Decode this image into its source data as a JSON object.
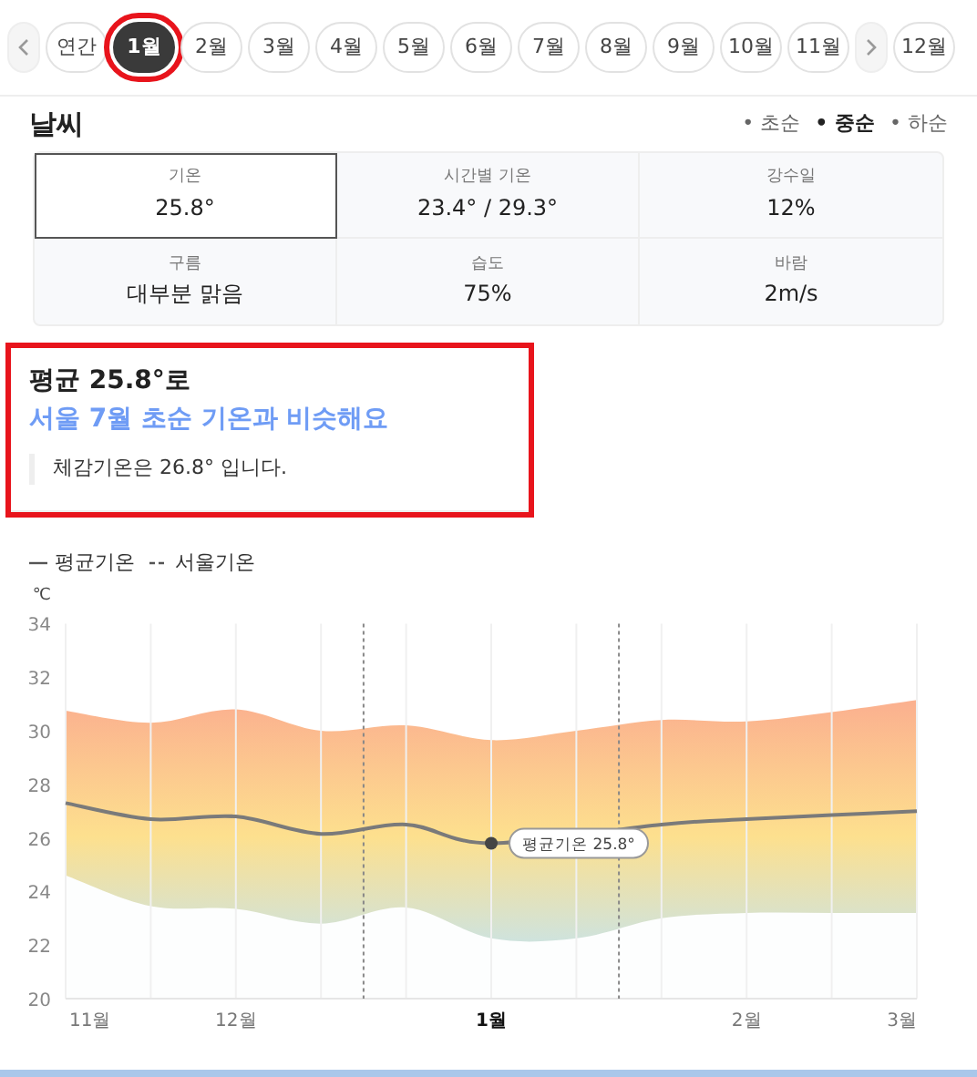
{
  "month_tabs": [
    {
      "label": "연간",
      "selected": false,
      "highlighted": false
    },
    {
      "label": "1월",
      "selected": true,
      "highlighted": true
    },
    {
      "label": "2월",
      "selected": false,
      "highlighted": false
    },
    {
      "label": "3월",
      "selected": false,
      "highlighted": false
    },
    {
      "label": "4월",
      "selected": false,
      "highlighted": false
    },
    {
      "label": "5월",
      "selected": false,
      "highlighted": false
    },
    {
      "label": "6월",
      "selected": false,
      "highlighted": false
    },
    {
      "label": "7월",
      "selected": false,
      "highlighted": false
    },
    {
      "label": "8월",
      "selected": false,
      "highlighted": false
    },
    {
      "label": "9월",
      "selected": false,
      "highlighted": false
    },
    {
      "label": "10월",
      "selected": false,
      "highlighted": false
    },
    {
      "label": "11월",
      "selected": false,
      "highlighted": false
    },
    {
      "label": "12월",
      "selected": false,
      "highlighted": false
    }
  ],
  "weather": {
    "title": "날씨",
    "periods": [
      {
        "label": "• 초순",
        "selected": false
      },
      {
        "label": "• 중순",
        "selected": true
      },
      {
        "label": "• 하순",
        "selected": false
      }
    ],
    "stats": [
      {
        "label": "기온",
        "value": "25.8°",
        "selected": true
      },
      {
        "label": "시간별 기온",
        "value": "23.4° / 29.3°",
        "selected": false
      },
      {
        "label": "강수일",
        "value": "12%",
        "selected": false
      },
      {
        "label": "구름",
        "value": "대부분 맑음",
        "selected": false
      },
      {
        "label": "습도",
        "value": "75%",
        "selected": false
      },
      {
        "label": "바람",
        "value": "2m/s",
        "selected": false
      }
    ]
  },
  "summary": {
    "highlighted": true,
    "headline": "평균 **25.8°**로",
    "comparison": "서울 7월 초순 기온과 비슷해요",
    "note": "체감기온은 26.8° 입니다."
  },
  "chart": {
    "chart_data": {
      "type": "area",
      "ylabel": "℃",
      "categories": [
        "11월",
        null,
        "12월",
        null,
        null,
        "1월",
        null,
        null,
        "2월",
        null,
        "3월"
      ],
      "yticks": [
        20,
        22,
        24,
        26,
        28,
        30,
        32,
        34
      ],
      "ylim": [
        20,
        34
      ],
      "grid": true,
      "series": [
        {
          "name": "평균기온",
          "type": "line",
          "color": "#7a7a7a",
          "values": [
            27.3,
            26.7,
            26.8,
            26.15,
            26.5,
            25.8,
            null,
            26.5,
            26.7,
            26.85,
            27.0
          ]
        },
        {
          "name": "서울기온",
          "type": "area",
          "color": "#fbb18f",
          "values": [
            30.75,
            30.3,
            30.8,
            30.0,
            30.2,
            29.65,
            30.0,
            30.4,
            30.35,
            30.7,
            31.15
          ]
        },
        {
          "type": "area",
          "color": "#fdfefe",
          "values": [
            24.6,
            23.45,
            23.35,
            22.8,
            23.4,
            22.25,
            22.25,
            23.0,
            23.2,
            23.2,
            23.2
          ]
        }
      ],
      "annotations": [
        {
          "x": "1월",
          "y": 25.8,
          "text": "평균기온 25.8°"
        }
      ]
    },
    "legend": [
      {
        "kind": "solid"
      },
      {
        "kind": "dashed"
      }
    ]
  }
}
